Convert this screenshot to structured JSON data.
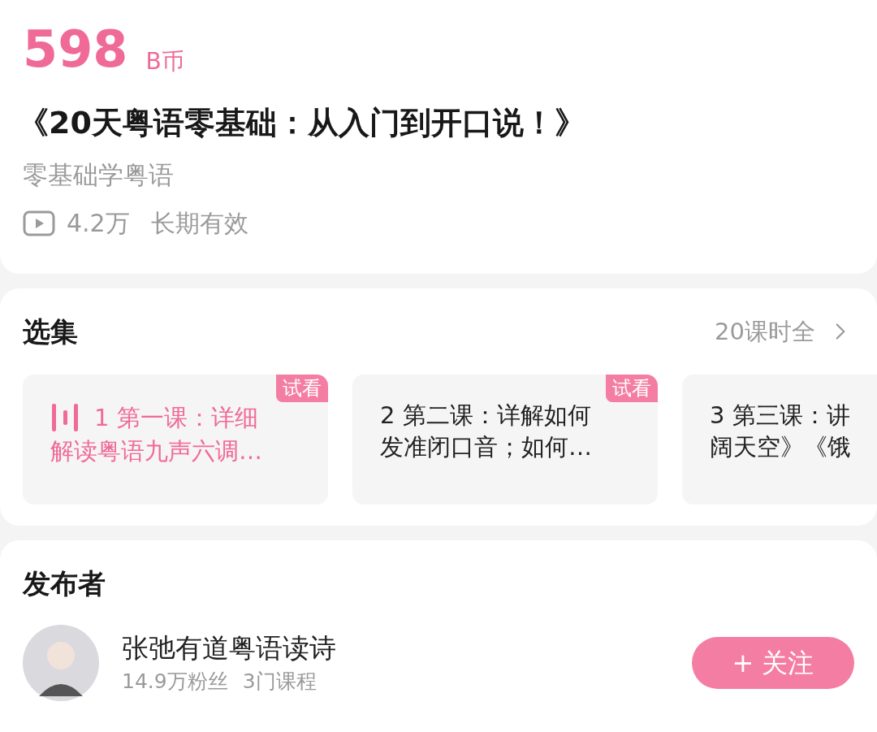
{
  "price": {
    "amount": "598",
    "unit": "B币"
  },
  "title": "《20天粤语零基础：从入门到开口说！》",
  "subtitle": "零基础学粤语",
  "stats": {
    "plays": "4.2万",
    "validity": "长期有效"
  },
  "episodes": {
    "heading": "选集",
    "summary": "20课时全",
    "items": [
      {
        "line1": "1 第一课：详细",
        "line2": "解读粤语九声六调…",
        "selected": true,
        "badge": "试看"
      },
      {
        "line1": "2 第二课：详解如何",
        "line2": "发准闭口音；如何…",
        "selected": false,
        "badge": "试看"
      },
      {
        "line1": "3 第三课：讲",
        "line2": "阔天空》《饿",
        "selected": false
      }
    ]
  },
  "publisher": {
    "heading": "发布者",
    "name": "张弛有道粤语读诗",
    "followers": "14.9万粉丝",
    "courses": "3门课程",
    "follow_button": "+ 关注"
  }
}
